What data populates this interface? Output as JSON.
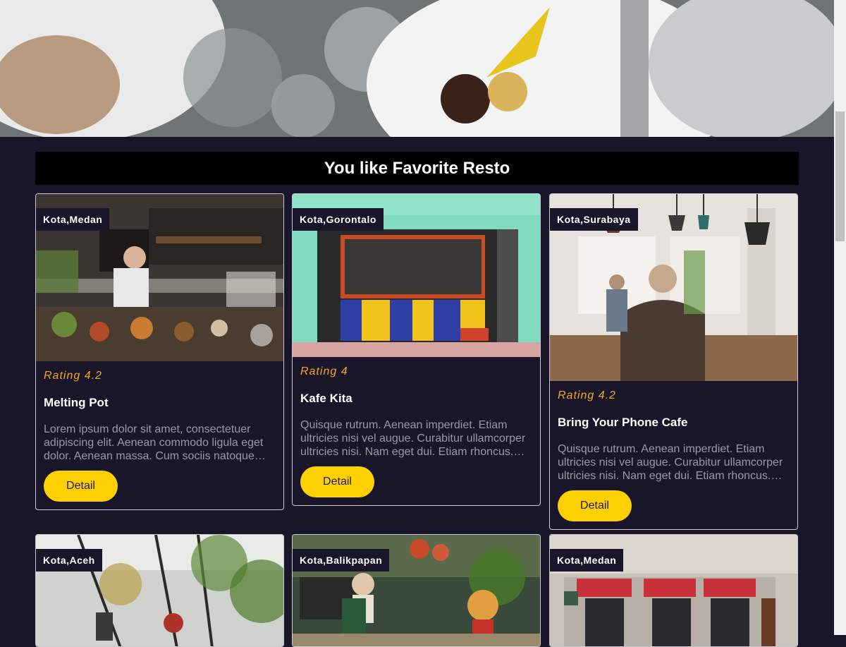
{
  "section": {
    "title": "You like Favorite Resto"
  },
  "restaurants": [
    {
      "city": "Kota,Medan",
      "rating": "Rating 4.2",
      "name": "Melting Pot",
      "description": "Lorem ipsum dolor sit amet, consectetuer adipiscing elit. Aenean commodo ligula eget dolor. Aenean massa. Cum sociis natoque penatibus et magnis dis parturient montes.",
      "detail_label": "Detail"
    },
    {
      "city": "Kota,Gorontalo",
      "rating": "Rating 4",
      "name": "Kafe Kita",
      "description": "Quisque rutrum. Aenean imperdiet. Etiam ultricies nisi vel augue. Curabitur ullamcorper ultricies nisi. Nam eget dui. Etiam rhoncus. Maecenas tempus.",
      "detail_label": "Detail"
    },
    {
      "city": "Kota,Surabaya",
      "rating": "Rating 4.2",
      "name": "Bring Your Phone Cafe",
      "description": "Quisque rutrum. Aenean imperdiet. Etiam ultricies nisi vel augue. Curabitur ullamcorper ultricies nisi. Nam eget dui. Etiam rhoncus. Maecenas tempus.",
      "detail_label": "Detail"
    },
    {
      "city": "Kota,Aceh"
    },
    {
      "city": "Kota,Balikpapan"
    },
    {
      "city": "Kota,Medan"
    }
  ],
  "colors": {
    "background": "#19162a",
    "accent": "#ffd000",
    "rating": "#f5a623"
  }
}
